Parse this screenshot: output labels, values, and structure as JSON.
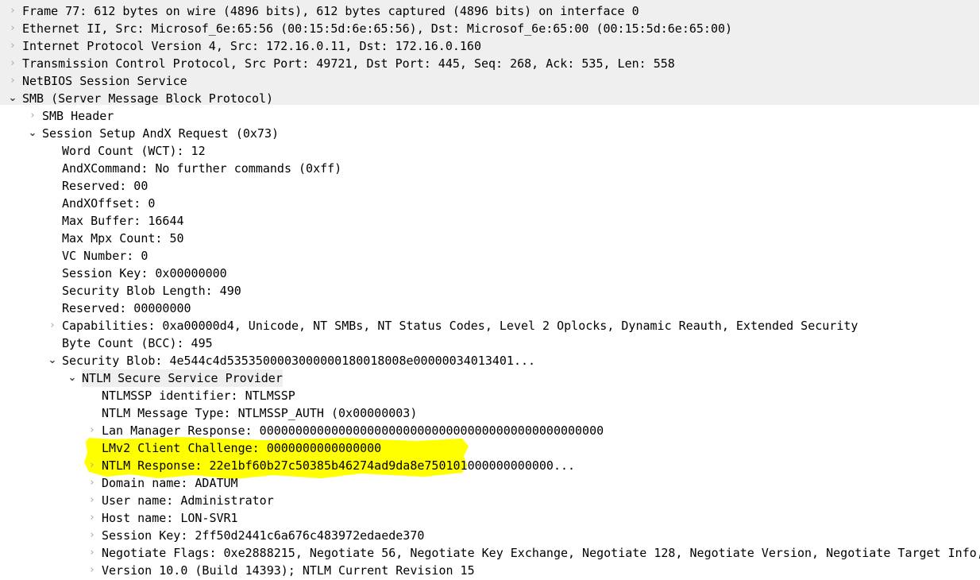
{
  "app": {
    "name": "Wireshark packet details pane",
    "view": "packet-detail-tree"
  },
  "colors": {
    "selection_background": "#efefef",
    "highlighter": "#ffff00",
    "text": "#000000",
    "chevron_collapsed": "#a6a6a6",
    "chevron_expanded": "#3b3b3b",
    "page_background": "#ffffff"
  },
  "icons": {
    "collapsed": "›",
    "expanded": "⌄"
  },
  "tree": [
    {
      "depth": 0,
      "state": "collapsed",
      "text": "Frame 77: 612 bytes on wire (4896 bits), 612 bytes captured (4896 bits) on interface 0",
      "selected": true
    },
    {
      "depth": 0,
      "state": "collapsed",
      "text": "Ethernet II, Src: Microsof_6e:65:56 (00:15:5d:6e:65:56), Dst: Microsof_6e:65:00 (00:15:5d:6e:65:00)",
      "selected": true
    },
    {
      "depth": 0,
      "state": "collapsed",
      "text": "Internet Protocol Version 4, Src: 172.16.0.11, Dst: 172.16.0.160",
      "selected": true
    },
    {
      "depth": 0,
      "state": "collapsed",
      "text": "Transmission Control Protocol, Src Port: 49721, Dst Port: 445, Seq: 268, Ack: 535, Len: 558",
      "selected": true
    },
    {
      "depth": 0,
      "state": "collapsed",
      "text": "NetBIOS Session Service",
      "selected": true
    },
    {
      "depth": 0,
      "state": "expanded",
      "text": "SMB (Server Message Block Protocol)",
      "selected": true
    },
    {
      "depth": 1,
      "state": "collapsed",
      "text": "SMB Header",
      "selected": false
    },
    {
      "depth": 1,
      "state": "expanded",
      "text": "Session Setup AndX Request (0x73)",
      "selected": false
    },
    {
      "depth": 2,
      "state": "none",
      "text": "Word Count (WCT): 12",
      "selected": false
    },
    {
      "depth": 2,
      "state": "none",
      "text": "AndXCommand: No further commands (0xff)",
      "selected": false
    },
    {
      "depth": 2,
      "state": "none",
      "text": "Reserved: 00",
      "selected": false
    },
    {
      "depth": 2,
      "state": "none",
      "text": "AndXOffset: 0",
      "selected": false
    },
    {
      "depth": 2,
      "state": "none",
      "text": "Max Buffer: 16644",
      "selected": false
    },
    {
      "depth": 2,
      "state": "none",
      "text": "Max Mpx Count: 50",
      "selected": false
    },
    {
      "depth": 2,
      "state": "none",
      "text": "VC Number: 0",
      "selected": false
    },
    {
      "depth": 2,
      "state": "none",
      "text": "Session Key: 0x00000000",
      "selected": false
    },
    {
      "depth": 2,
      "state": "none",
      "text": "Security Blob Length: 490",
      "selected": false
    },
    {
      "depth": 2,
      "state": "none",
      "text": "Reserved: 00000000",
      "selected": false
    },
    {
      "depth": 2,
      "state": "collapsed",
      "text": "Capabilities: 0xa00000d4, Unicode, NT SMBs, NT Status Codes, Level 2 Oplocks, Dynamic Reauth, Extended Security",
      "selected": false
    },
    {
      "depth": 2,
      "state": "none",
      "text": "Byte Count (BCC): 495",
      "selected": false
    },
    {
      "depth": 2,
      "state": "expanded",
      "text": "Security Blob: 4e544c4d5353500003000000180018008e00000034013401...",
      "selected": false
    },
    {
      "depth": 3,
      "state": "expanded",
      "text": "NTLM Secure Service Provider",
      "selected": true
    },
    {
      "depth": 4,
      "state": "none",
      "text": "NTLMSSP identifier: NTLMSSP",
      "selected": false
    },
    {
      "depth": 4,
      "state": "none",
      "text": "NTLM Message Type: NTLMSSP_AUTH (0x00000003)",
      "selected": false
    },
    {
      "depth": 4,
      "state": "collapsed",
      "text": "Lan Manager Response: 000000000000000000000000000000000000000000000000",
      "selected": false
    },
    {
      "depth": 4,
      "state": "none",
      "text": "LMv2 Client Challenge: 0000000000000000",
      "selected": false
    },
    {
      "depth": 4,
      "state": "collapsed",
      "text": "NTLM Response: 22e1bf60b27c50385b46274ad9da8e750101000000000000...",
      "selected": false
    },
    {
      "depth": 4,
      "state": "collapsed",
      "text": "Domain name: ADATUM",
      "selected": false
    },
    {
      "depth": 4,
      "state": "collapsed",
      "text": "User name: Administrator",
      "selected": false
    },
    {
      "depth": 4,
      "state": "collapsed",
      "text": "Host name: LON-SVR1",
      "selected": false
    },
    {
      "depth": 4,
      "state": "collapsed",
      "text": "Session Key: 2ff50d2441c6a676c483972edaede370",
      "selected": false
    },
    {
      "depth": 4,
      "state": "collapsed",
      "text": "Negotiate Flags: 0xe2888215, Negotiate 56, Negotiate Key Exchange, Negotiate 128, Negotiate Version, Negotiate Target Info,",
      "selected": false
    },
    {
      "depth": 4,
      "state": "collapsed",
      "text": "Version 10.0 (Build 14393); NTLM Current Revision 15",
      "selected": false
    }
  ],
  "annotation": {
    "type": "highlighter-stroke",
    "color": "#ffff00",
    "covers_rows": [
      "LMv2 Client Challenge: 0000000000000000",
      "NTLM Response: 22e1bf60b27c50385b46274ad9da8e750101000000000000...",
      "Domain name: ADATUM"
    ]
  }
}
